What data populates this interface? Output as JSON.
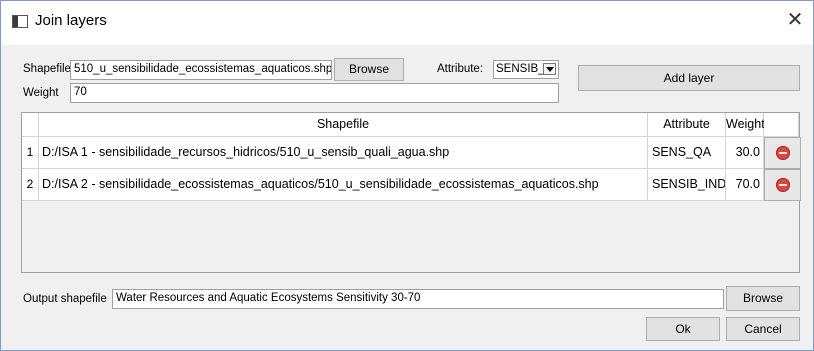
{
  "window": {
    "title": "Join layers",
    "close_symbol": "✕"
  },
  "shapefile": {
    "label": "Shapefile",
    "value": "510_u_sensibilidade_ecossistemas_aquaticos.shp",
    "browse_label": "Browse"
  },
  "attribute": {
    "label": "Attribute:",
    "selected": "SENSIB_"
  },
  "weight": {
    "label": "Weight",
    "value": "70"
  },
  "add_layer_label": "Add layer",
  "table": {
    "headers": [
      "Shapefile",
      "Attribute",
      "Weight"
    ],
    "rows": [
      {
        "num": "1",
        "shapefile": "D:/ISA 1 - sensibilidade_recursos_hidricos/510_u_sensib_quali_agua.shp",
        "attribute": "SENS_QA",
        "weight": "30.0"
      },
      {
        "num": "2",
        "shapefile": "D:/ISA 2 - sensibilidade_ecossistemas_aquaticos/510_u_sensibilidade_ecossistemas_aquaticos.shp",
        "attribute": "SENSIB_IND",
        "weight": "70.0"
      }
    ]
  },
  "output": {
    "label": "Output shapefile",
    "value": "Water Resources and Aquatic Ecosystems Sensitivity 30-70",
    "browse_label": "Browse"
  },
  "ok_label": "Ok",
  "cancel_label": "Cancel",
  "colors": {
    "remove_icon": "#e0453d",
    "title_bar": "#ffffff",
    "dialog_bg": "#f0f0f0"
  }
}
